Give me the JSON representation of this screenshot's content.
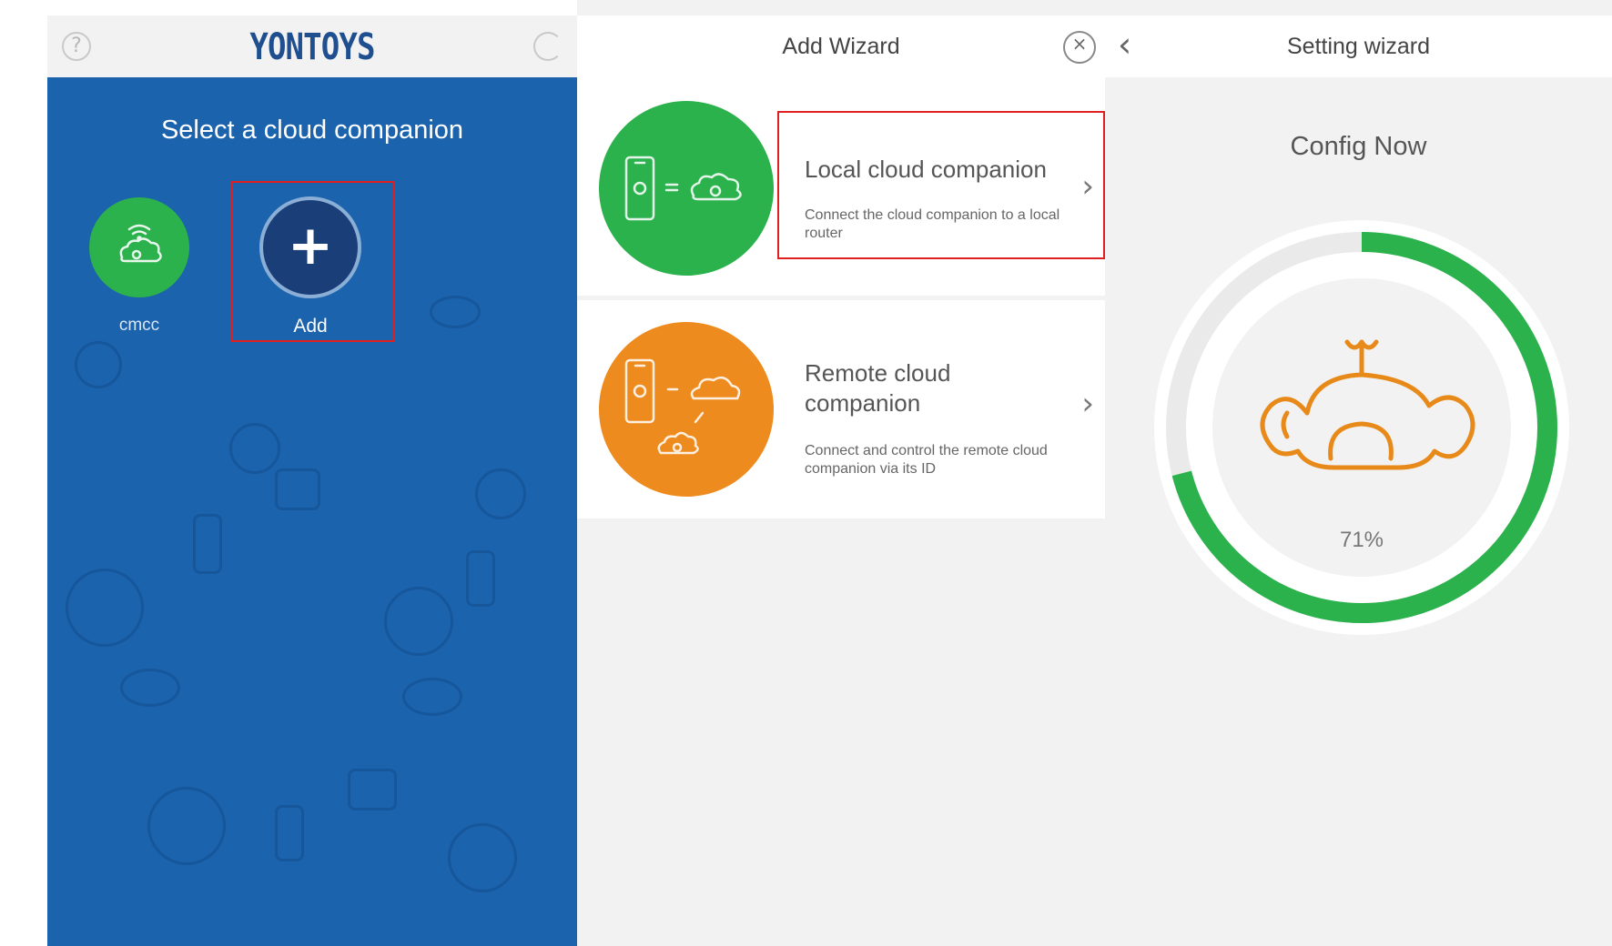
{
  "panel1": {
    "brand": "YONTOYS",
    "select_title": "Select a cloud companion",
    "device_label": "cmcc",
    "add_label": "Add",
    "help_icon_glyph": "?",
    "colors": {
      "header": "#f2f2f2",
      "brand": "#1f4f8f",
      "background": "#1b63ad",
      "device": "#2bb24c",
      "add": "#1a3f78",
      "highlight": "#e02020"
    }
  },
  "panel2": {
    "title": "Add Wizard",
    "close_glyph": "×",
    "options": [
      {
        "title": "Local cloud companion",
        "description": "Connect the cloud companion to a local router",
        "icon": "phone-to-cloud-icon",
        "color": "#2bb24c"
      },
      {
        "title": "Remote cloud companion",
        "description": "Connect and control the remote cloud companion via its ID",
        "icon": "remote-phone-cloud-icon",
        "color": "#ee8b1f"
      }
    ],
    "chevron": "›"
  },
  "panel3": {
    "back_glyph": "‹",
    "title": "Setting wizard",
    "config_label": "Config Now",
    "progress": 71,
    "progress_label": "71%",
    "colors": {
      "progress": "#2bb24c",
      "mascot": "#e88a1a"
    }
  }
}
